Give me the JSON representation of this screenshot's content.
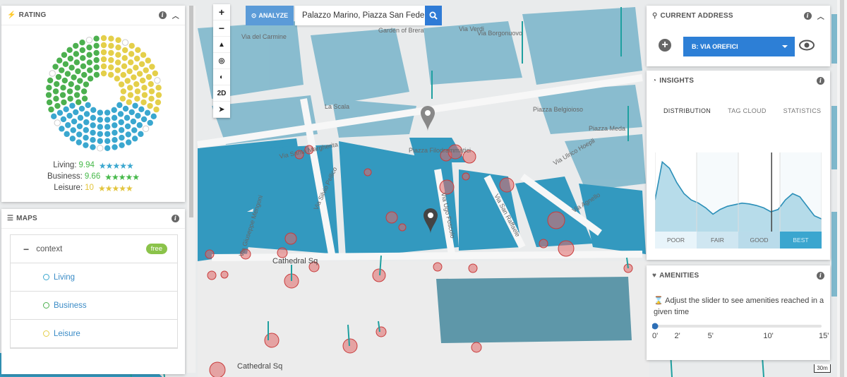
{
  "search": {
    "analyze_label": "ANALYZE",
    "value": "Palazzo Marino, Piazza San Fedele"
  },
  "map_controls": {
    "zoom_in": "+",
    "zoom_out": "−",
    "mode": "2D"
  },
  "map": {
    "street_labels": [
      "Via del Carmine",
      "Garden of Brera",
      "Via Verdi",
      "Via Brera",
      "Via Borgonuovo",
      "La Scala",
      "Piazza Belgioioso",
      "Piazza Meda",
      "Via Santa Margherita",
      "Via Silvio Pellico",
      "Via Ugo Foscolo",
      "Via San Raffaele",
      "Via Agnello",
      "Via Giuseppe Mengoni",
      "Cathedral Sq",
      "Via Ulrico Hoepli",
      "Piazza Filodrammatici",
      "Cathedral Sq"
    ],
    "scale": "30m"
  },
  "rating": {
    "title": "RATING",
    "rows": [
      {
        "label": "Living:",
        "value": "9.94",
        "color": "#46b94a"
      },
      {
        "label": "Business:",
        "value": "9.66",
        "color": "#46b94a"
      },
      {
        "label": "Leisure:",
        "value": "10",
        "color": "#e3c53d"
      }
    ],
    "colors": {
      "living": "#4cb04f",
      "business": "#3aa7cf",
      "leisure": "#e4cf4a"
    }
  },
  "maps": {
    "title": "MAPS",
    "context_label": "context",
    "free_label": "free",
    "layers": [
      {
        "label": "Living",
        "color": "#3aa7cf"
      },
      {
        "label": "Business",
        "color": "#4cb04f"
      },
      {
        "label": "Leisure",
        "color": "#e4cf4a"
      }
    ]
  },
  "address": {
    "title": "CURRENT ADDRESS",
    "selected": "B: VIA OREFICI"
  },
  "insights": {
    "title": "INSIGHTS",
    "tabs": [
      "DISTRIBUTION",
      "TAG CLOUD",
      "STATISTICS"
    ],
    "bands": [
      "POOR",
      "FAIR",
      "GOOD",
      "BEST"
    ],
    "distribution": [
      0.4,
      0.88,
      0.8,
      0.62,
      0.48,
      0.4,
      0.36,
      0.3,
      0.22,
      0.28,
      0.32,
      0.34,
      0.36,
      0.35,
      0.33,
      0.3,
      0.25,
      0.28,
      0.4,
      0.48,
      0.44,
      0.32,
      0.2,
      0.16
    ],
    "marker": 0.7
  },
  "amenities": {
    "title": "AMENITIES",
    "hint": "Adjust the slider to see amenities reached in a given time",
    "ticks": [
      "0'",
      "2'",
      "5'",
      "10'",
      "15'"
    ],
    "slider_value": 0
  }
}
